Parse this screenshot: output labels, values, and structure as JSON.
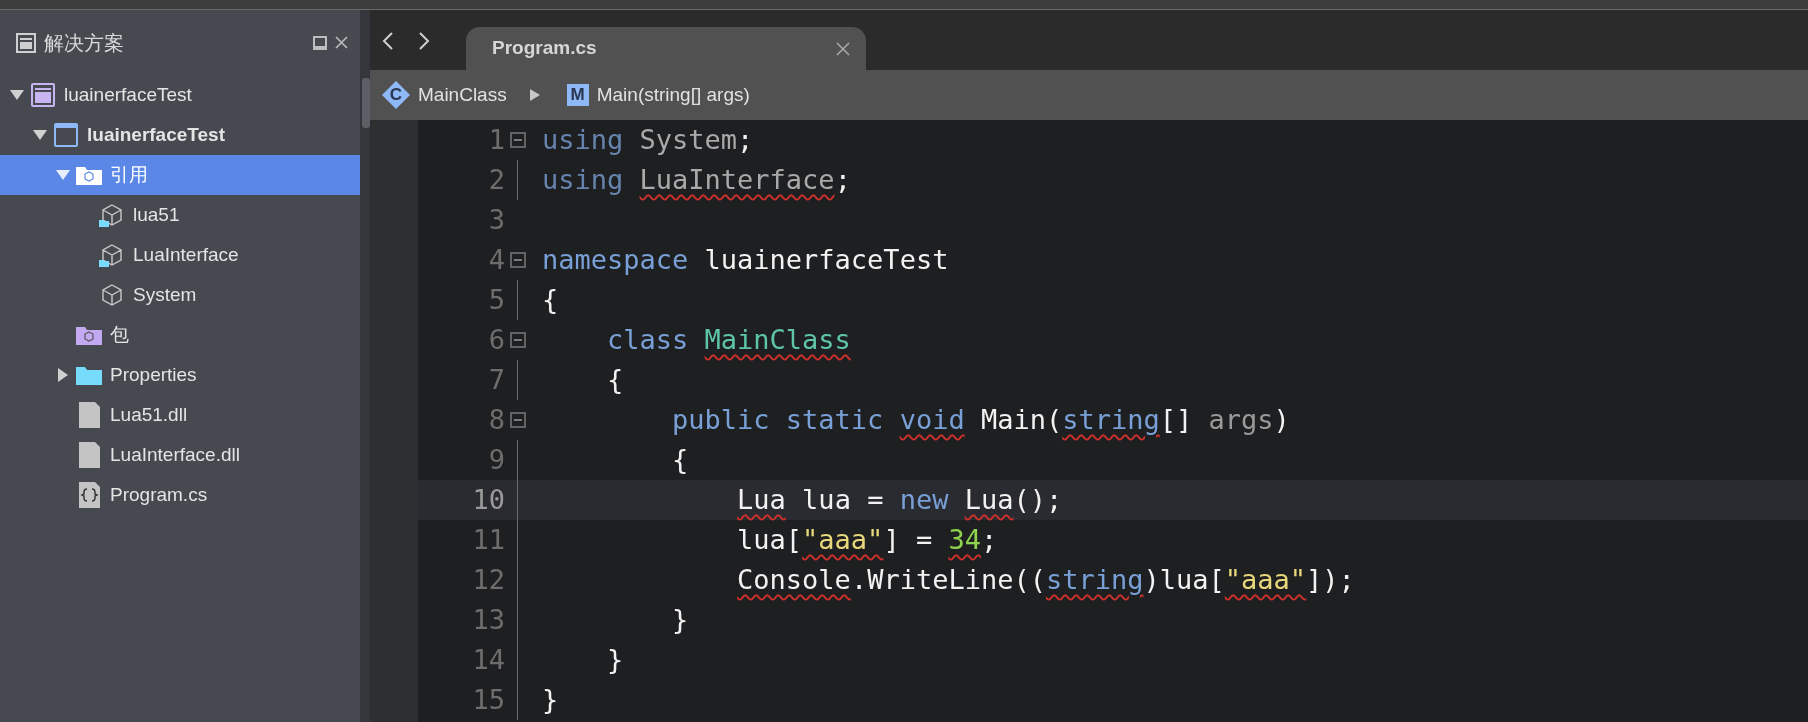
{
  "solution_panel": {
    "title": "解决方案",
    "tree": [
      {
        "label": "luainerfaceTest",
        "kind": "solution",
        "expanded": true,
        "selected": false,
        "bold": false,
        "children": [
          {
            "label": "luainerfaceTest",
            "kind": "project",
            "expanded": true,
            "selected": false,
            "bold": true,
            "children": [
              {
                "label": "引用",
                "kind": "references",
                "expanded": true,
                "selected": true,
                "bold": false,
                "children": [
                  {
                    "label": "lua51",
                    "kind": "local-assembly",
                    "selected": false,
                    "bold": false
                  },
                  {
                    "label": "LuaInterface",
                    "kind": "local-assembly",
                    "selected": false,
                    "bold": false
                  },
                  {
                    "label": "System",
                    "kind": "assembly",
                    "selected": false,
                    "bold": false
                  }
                ]
              },
              {
                "label": "包",
                "kind": "packages",
                "selected": false,
                "bold": false
              },
              {
                "label": "Properties",
                "kind": "folder",
                "expanded": false,
                "selected": false,
                "bold": false
              },
              {
                "label": "Lua51.dll",
                "kind": "file",
                "selected": false,
                "bold": false
              },
              {
                "label": "LuaInterface.dll",
                "kind": "file",
                "selected": false,
                "bold": false
              },
              {
                "label": "Program.cs",
                "kind": "code-file",
                "selected": false,
                "bold": false
              }
            ]
          }
        ]
      }
    ]
  },
  "editor": {
    "tabs": [
      {
        "label": "Program.cs",
        "selected": true
      }
    ],
    "breadcrumb": [
      {
        "kind": "class",
        "letter": "C",
        "label": "MainClass"
      },
      {
        "kind": "method",
        "letter": "M",
        "label": "Main(string[] args)"
      }
    ],
    "lines": [
      {
        "number": "1",
        "collapsible": true,
        "current": false,
        "tokens": [
          {
            "text": "using ",
            "kind": "directive"
          },
          {
            "text": "System",
            "kind": "muted"
          },
          {
            "text": ";",
            "kind": "plain"
          }
        ]
      },
      {
        "number": "2",
        "collapsible": false,
        "current": false,
        "tokens": [
          {
            "text": "using ",
            "kind": "directive"
          },
          {
            "text": "LuaInterface",
            "kind": "muted",
            "squiggle": true
          },
          {
            "text": ";",
            "kind": "plain"
          }
        ]
      },
      {
        "number": "3",
        "collapsible": false,
        "current": false
      },
      {
        "number": "4",
        "collapsible": true,
        "current": false,
        "tokens": [
          {
            "text": "namespace ",
            "kind": "keyword"
          },
          {
            "text": "luainerfaceTest",
            "kind": "plain"
          }
        ]
      },
      {
        "number": "5",
        "collapsible": false,
        "current": false,
        "tokens": [
          {
            "text": "{",
            "kind": "plain"
          }
        ]
      },
      {
        "number": "6",
        "collapsible": true,
        "current": false,
        "tokens": [
          {
            "text": "    class ",
            "kind": "keyword"
          },
          {
            "text": "MainClass",
            "kind": "type",
            "squiggle": true
          }
        ]
      },
      {
        "number": "7",
        "collapsible": false,
        "current": false,
        "tokens": [
          {
            "text": "    {",
            "kind": "plain"
          }
        ]
      },
      {
        "number": "8",
        "collapsible": true,
        "current": false,
        "tokens": [
          {
            "text": "        public static ",
            "kind": "keyword"
          },
          {
            "text": "void",
            "kind": "keyword",
            "squiggle": true
          },
          {
            "text": " Main(",
            "kind": "plain"
          },
          {
            "text": "string",
            "kind": "keyword",
            "squiggle": true
          },
          {
            "text": "[] ",
            "kind": "plain"
          },
          {
            "text": "args",
            "kind": "param"
          },
          {
            "text": ")",
            "kind": "plain"
          }
        ]
      },
      {
        "number": "9",
        "collapsible": false,
        "current": false,
        "tokens": [
          {
            "text": "        {",
            "kind": "plain"
          }
        ]
      },
      {
        "number": "10",
        "collapsible": false,
        "current": true,
        "tokens": [
          {
            "text": "            Lua",
            "kind": "plain",
            "squiggle": true
          },
          {
            "text": " lua = ",
            "kind": "plain"
          },
          {
            "text": "new ",
            "kind": "keyword"
          },
          {
            "text": "Lua",
            "kind": "plain",
            "squiggle": true
          },
          {
            "text": "();",
            "kind": "plain"
          }
        ]
      },
      {
        "number": "11",
        "collapsible": false,
        "current": false,
        "tokens": [
          {
            "text": "            lua[",
            "kind": "plain"
          },
          {
            "text": "\"aaa\"",
            "kind": "string",
            "squiggle": true
          },
          {
            "text": "] = ",
            "kind": "plain"
          },
          {
            "text": "34",
            "kind": "number",
            "squiggle": true
          },
          {
            "text": ";",
            "kind": "plain"
          }
        ]
      },
      {
        "number": "12",
        "collapsible": false,
        "current": false,
        "tokens": [
          {
            "text": "            Console",
            "kind": "plain",
            "squiggle": true
          },
          {
            "text": ".WriteLine((",
            "kind": "plain"
          },
          {
            "text": "string",
            "kind": "keyword",
            "squiggle": true
          },
          {
            "text": ")lua[",
            "kind": "plain"
          },
          {
            "text": "\"aaa\"",
            "kind": "string",
            "squiggle": true
          },
          {
            "text": "]);",
            "kind": "plain"
          }
        ]
      },
      {
        "number": "13",
        "collapsible": false,
        "current": false,
        "tokens": [
          {
            "text": "        }",
            "kind": "plain"
          }
        ]
      },
      {
        "number": "14",
        "collapsible": false,
        "current": false,
        "tokens": [
          {
            "text": "    }",
            "kind": "plain"
          }
        ]
      },
      {
        "number": "15",
        "collapsible": false,
        "current": false,
        "tokens": [
          {
            "text": "}",
            "kind": "plain"
          }
        ]
      }
    ]
  }
}
